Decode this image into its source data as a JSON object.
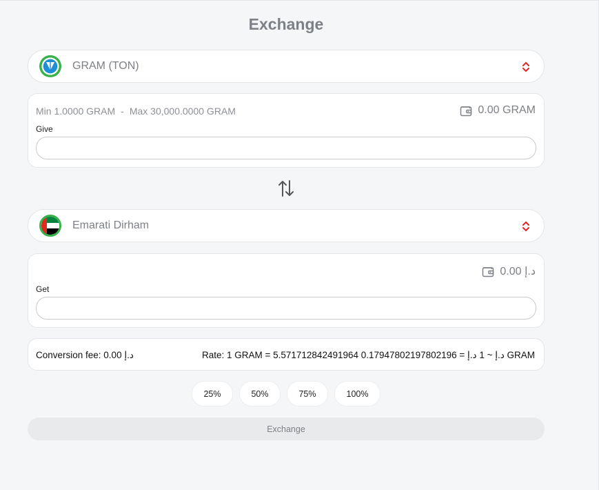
{
  "page": {
    "title": "Exchange"
  },
  "from_currency": {
    "name": "GRAM (TON)",
    "icon": "gram-ton-coin-icon"
  },
  "give": {
    "min": "Min 1.0000 GRAM",
    "separator": "-",
    "max": "Max 30,000.0000 GRAM",
    "balance": "0.00 GRAM",
    "label": "Give",
    "value": "",
    "placeholder": ""
  },
  "to_currency": {
    "name": "Emarati Dirham",
    "icon": "uae-flag-icon"
  },
  "get": {
    "balance": "0.00 د.إ",
    "label": "Get",
    "value": "",
    "placeholder": ""
  },
  "info": {
    "fee": "Conversion fee: 0.00 د.إ",
    "rate": "Rate: 1 GRAM = 5.571712842491964 د.إ ~ 1 د.إ = 0.17947802197802196 GRAM"
  },
  "percent_buttons": [
    "25%",
    "50%",
    "75%",
    "100%"
  ],
  "submit": {
    "label": "Exchange",
    "state": "disabled"
  },
  "colors": {
    "accent": "#e02424",
    "muted_text": "#7d8086",
    "background": "#f5f6f7"
  }
}
